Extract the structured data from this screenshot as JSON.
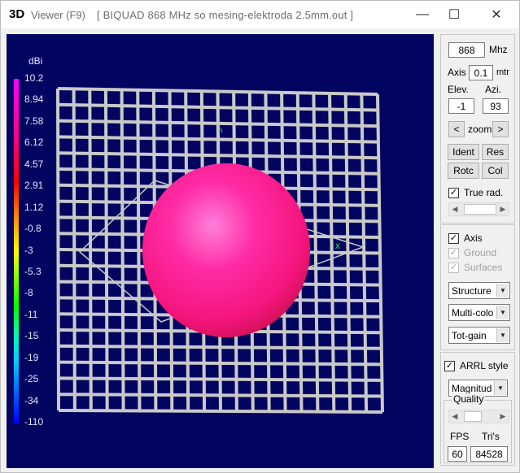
{
  "window": {
    "title_badge": "3D",
    "title_app": "Viewer (F9)",
    "title_file": "[ BIQUAD 868 MHz so mesing-elektroda 2.5mm.out ]",
    "controls": {
      "minimize": "—",
      "maximize": "☐",
      "close": "✕"
    }
  },
  "legend": {
    "unit": "dBi",
    "ticks": [
      "10.2",
      "8.94",
      "7.58",
      "6.12",
      "4.57",
      "2.91",
      "1.12",
      "-0.8",
      "-3",
      "-5.3",
      "-8",
      "-11",
      "-15",
      "-19",
      "-25",
      "-34",
      "-110"
    ]
  },
  "viewport": {
    "background": "#020560",
    "ground_grid_color": "#c9c9c9",
    "pattern_color": "#ff1a8c"
  },
  "panel": {
    "frequency": "868",
    "frequency_unit": "Mhz",
    "axis_label": "Axis",
    "axis_value": "0.1",
    "axis_unit": "mtr",
    "elev_label": "Elev.",
    "azi_label": "Azi.",
    "elev_value": "-1",
    "azi_value": "93",
    "zoom_label": "zoom",
    "zoom_in": "<",
    "zoom_out": ">",
    "ident": "Ident",
    "res": "Res",
    "rotc": "Rotc",
    "col": "Col",
    "true_rad": {
      "label": "True rad.",
      "checked": true
    },
    "axis_check": {
      "label": "Axis",
      "checked": true
    },
    "ground_check": {
      "label": "Ground",
      "checked": true,
      "disabled": true
    },
    "surfaces_check": {
      "label": "Surfaces",
      "checked": true,
      "disabled": true
    },
    "structure_select": "Structure",
    "color_select": "Multi-colo",
    "gain_select": "Tot-gain",
    "arrl_style": {
      "label": "ARRL style",
      "checked": true
    },
    "magnitude_select": "Magnitud",
    "quality_label": "Quality",
    "fps_label": "FPS",
    "tris_label": "Tri's",
    "fps_value": "60",
    "tris_value": "84528"
  }
}
